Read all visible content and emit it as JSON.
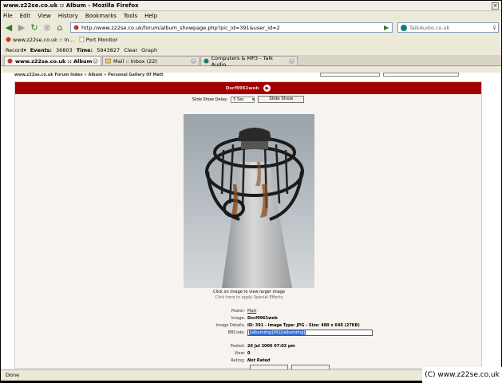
{
  "window": {
    "title": "www.z22se.co.uk :: Album - Mozilla Firefox",
    "close_glyph": "×"
  },
  "menu": [
    "File",
    "Edit",
    "View",
    "History",
    "Bookmarks",
    "Tools",
    "Help"
  ],
  "nav": {
    "url": "http://www.z22se.co.uk/forum/album_showpage.php?pic_id=391&user_id=2",
    "search_placeholder": "TalkAudio.co.uk"
  },
  "bookmarks": [
    {
      "label": "www.z22se.co.uk :: In..."
    },
    {
      "label": "Port Monitor"
    }
  ],
  "recordbar": {
    "record_label": "Record",
    "events_label": "Events:",
    "events_value": "36803",
    "time_label": "Time:",
    "time_value": "5943827",
    "clear_label": "Clear",
    "graph_label": "Graph"
  },
  "tabs": [
    {
      "label": "www.z22se.co.uk :: Album",
      "active": true
    },
    {
      "label": "Mail :: Inbox (22)",
      "active": false
    },
    {
      "label": "Computers & MP3 - Talk Audio...",
      "active": false
    }
  ],
  "page": {
    "breadcrumb": "www.z22se.co.uk Forum Index » Album » Personal Gallery Of Matt",
    "pic_title": "Dscf0961web",
    "slide_delay_label": "Slide Show Delay:",
    "slide_delay_value": "5 Sec",
    "slide_show_button": "Slide Show",
    "caption1": "Click on image to view larger image",
    "caption2": "Click here to apply Special Effects",
    "details": {
      "poster_label": "Poster:",
      "poster_value": "Matt",
      "image_label": "Image:",
      "image_value": "Dscf0961web",
      "image_details_label": "Image Details:",
      "image_details_value": "ID: 391 - Image Type: JPG - Size: 480 x 640 (27KB)",
      "bbcode_label": "BBCode:",
      "bbcode_value": "[albumimg]391[/albumimg]",
      "posted_label": "Posted:",
      "posted_value": "26 Jul 2006 07:03 pm",
      "view_label": "View:",
      "view_value": "0",
      "rating_label": "Rating:",
      "rating_value": "Not Rated"
    }
  },
  "status": "Done",
  "watermark": "(C) www.z22se.co.uk",
  "colors": {
    "header_red": "#a00000",
    "accent_green": "#2a7a2a"
  }
}
